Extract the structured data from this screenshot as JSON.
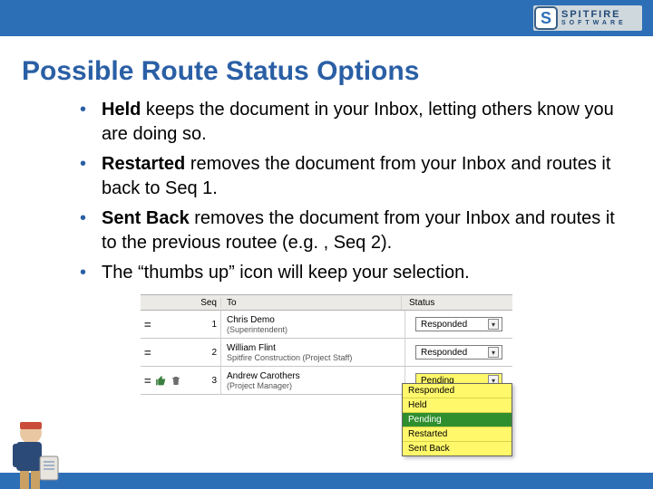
{
  "brand": {
    "initial": "S",
    "name": "SPITFIRE",
    "sub": "SOFTWARE"
  },
  "title": "Possible Route Status Options",
  "bullets": {
    "b0_strong": "Held",
    "b0_rest": " keeps the document in your Inbox, letting others know you are doing so.",
    "b1_strong": "Restarted",
    "b1_rest": " removes the document from your Inbox and routes it back to Seq 1.",
    "b2_strong": "Sent Back",
    "b2_rest": " removes the document from your Inbox and routes it to the previous routee (e.g. , Seq 2).",
    "b3": "The “thumbs up” icon will keep your selection."
  },
  "table": {
    "headers": {
      "seq": "Seq",
      "to": "To",
      "status": "Status"
    },
    "rows": [
      {
        "seq": "1",
        "name": "Chris Demo",
        "role": "(Superintendent)",
        "status": "Responded"
      },
      {
        "seq": "2",
        "name": "William Flint",
        "role": "Spitfire Construction (Project Staff)",
        "status": "Responded"
      },
      {
        "seq": "3",
        "name": "Andrew Carothers",
        "role": "(Project Manager)",
        "status": "Pending"
      }
    ],
    "dropdown_options": [
      "Responded",
      "Held",
      "Pending",
      "Restarted",
      "Sent Back"
    ],
    "dropdown_selected": "Pending"
  }
}
